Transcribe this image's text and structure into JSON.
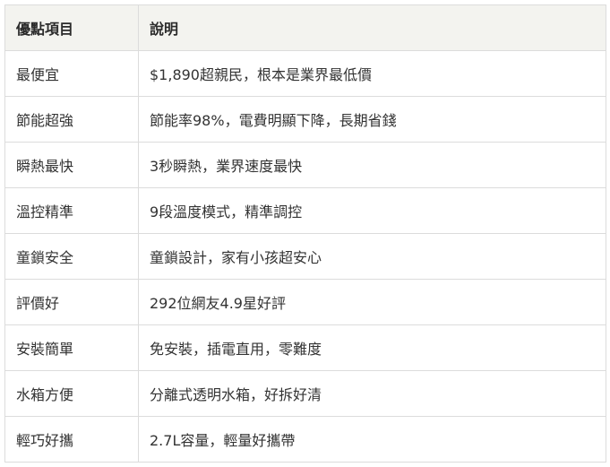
{
  "table": {
    "headers": [
      "優點項目",
      "說明"
    ],
    "rows": [
      {
        "item": "最便宜",
        "desc": "$1,890超親民，根本是業界最低價"
      },
      {
        "item": "節能超強",
        "desc": "節能率98%，電費明顯下降，長期省錢"
      },
      {
        "item": "瞬熱最快",
        "desc": "3秒瞬熱，業界速度最快"
      },
      {
        "item": "溫控精準",
        "desc": "9段溫度模式，精準調控"
      },
      {
        "item": "童鎖安全",
        "desc": "童鎖設計，家有小孩超安心"
      },
      {
        "item": "評價好",
        "desc": "292位網友4.9星好評"
      },
      {
        "item": "安裝簡單",
        "desc": "免安裝，插電直用，零難度"
      },
      {
        "item": "水箱方便",
        "desc": "分離式透明水箱，好拆好清"
      },
      {
        "item": "輕巧好攜",
        "desc": "2.7L容量，輕量好攜帶"
      }
    ]
  }
}
